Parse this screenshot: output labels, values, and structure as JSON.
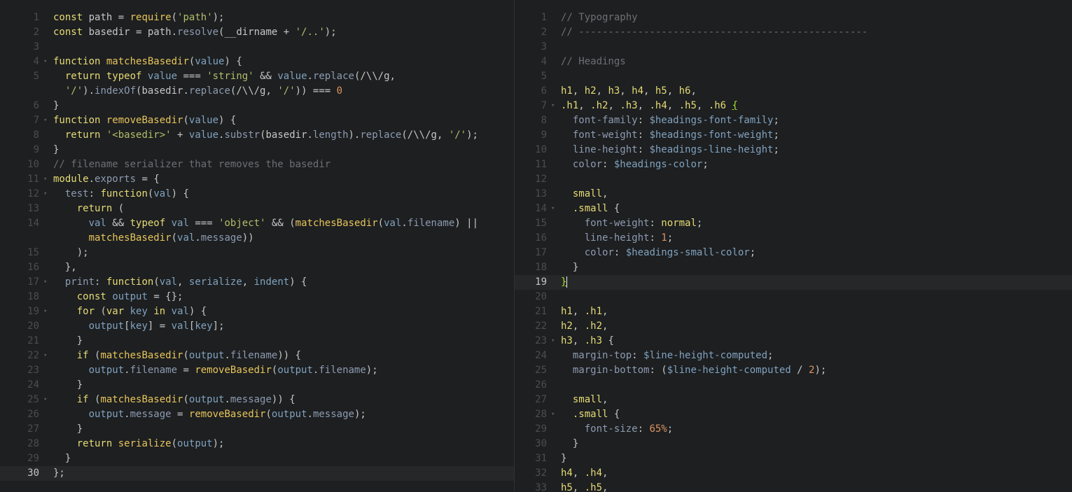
{
  "left_pane": {
    "lines": [
      {
        "n": "1",
        "fold": false,
        "html": "<span class=\"kw\">const</span> path = <span class=\"fn\">require</span>(<span class=\"str\">'path'</span>);"
      },
      {
        "n": "2",
        "fold": false,
        "html": "<span class=\"kw\">const</span> basedir = path.<span class=\"prop\">resolve</span>(__dirname + <span class=\"str\">'/..'</span>);"
      },
      {
        "n": "3",
        "fold": false,
        "html": ""
      },
      {
        "n": "4",
        "fold": true,
        "html": "<span class=\"kw\">function</span> <span class=\"fn\">matchesBasedir</span>(<span class=\"var\">value</span>) {"
      },
      {
        "n": "5",
        "fold": false,
        "html": "  <span class=\"kw\">return</span> <span class=\"kw\">typeof</span> <span class=\"var\">value</span> === <span class=\"str\">'string'</span> &amp;&amp; <span class=\"var\">value</span>.<span class=\"prop\">replace</span>(/\\\\/g,"
      },
      {
        "n": "",
        "fold": false,
        "html": "  <span class=\"str\">'/'</span>).<span class=\"prop\">indexOf</span>(basedir.<span class=\"prop\">replace</span>(/\\\\/g, <span class=\"str\">'/'</span>)) === <span class=\"num\">0</span>"
      },
      {
        "n": "6",
        "fold": false,
        "html": "}"
      },
      {
        "n": "7",
        "fold": true,
        "html": "<span class=\"kw\">function</span> <span class=\"fn\">removeBasedir</span>(<span class=\"var\">value</span>) {"
      },
      {
        "n": "8",
        "fold": false,
        "html": "  <span class=\"kw\">return</span> <span class=\"str\">'&lt;basedir&gt;'</span> + <span class=\"var\">value</span>.<span class=\"prop\">substr</span>(basedir.<span class=\"prop\">length</span>).<span class=\"prop\">replace</span>(/\\\\/g, <span class=\"str\">'/'</span>);"
      },
      {
        "n": "9",
        "fold": false,
        "html": "}"
      },
      {
        "n": "10",
        "fold": false,
        "html": "<span class=\"cmt\">// filename serializer that removes the basedir</span>"
      },
      {
        "n": "11",
        "fold": true,
        "html": "<span class=\"kw\">module</span>.<span class=\"prop\">exports</span> = {"
      },
      {
        "n": "12",
        "fold": true,
        "html": "  <span class=\"prop\">test</span>: <span class=\"kw\">function</span>(<span class=\"var\">val</span>) {"
      },
      {
        "n": "13",
        "fold": false,
        "html": "    <span class=\"kw\">return</span> ("
      },
      {
        "n": "14",
        "fold": false,
        "html": "      <span class=\"var\">val</span> &amp;&amp; <span class=\"kw\">typeof</span> <span class=\"var\">val</span> === <span class=\"str\">'object'</span> &amp;&amp; (<span class=\"fn\">matchesBasedir</span>(<span class=\"var\">val</span>.<span class=\"prop\">filename</span>) ||"
      },
      {
        "n": "",
        "fold": false,
        "html": "      <span class=\"fn\">matchesBasedir</span>(<span class=\"var\">val</span>.<span class=\"prop\">message</span>))"
      },
      {
        "n": "15",
        "fold": false,
        "html": "    );"
      },
      {
        "n": "16",
        "fold": false,
        "html": "  },"
      },
      {
        "n": "17",
        "fold": true,
        "html": "  <span class=\"prop\">print</span>: <span class=\"kw\">function</span>(<span class=\"var\">val</span>, <span class=\"var\">serialize</span>, <span class=\"var\">indent</span>) {"
      },
      {
        "n": "18",
        "fold": false,
        "html": "    <span class=\"kw\">const</span> <span class=\"var\">output</span> = {};"
      },
      {
        "n": "19",
        "fold": true,
        "html": "    <span class=\"kw\">for</span> (<span class=\"kw\">var</span> <span class=\"var\">key</span> <span class=\"kw\">in</span> <span class=\"var\">val</span>) {"
      },
      {
        "n": "20",
        "fold": false,
        "html": "      <span class=\"var\">output</span>[<span class=\"var\">key</span>] = <span class=\"var\">val</span>[<span class=\"var\">key</span>];"
      },
      {
        "n": "21",
        "fold": false,
        "html": "    }"
      },
      {
        "n": "22",
        "fold": true,
        "html": "    <span class=\"kw\">if</span> (<span class=\"fn\">matchesBasedir</span>(<span class=\"var\">output</span>.<span class=\"prop\">filename</span>)) {"
      },
      {
        "n": "23",
        "fold": false,
        "html": "      <span class=\"var\">output</span>.<span class=\"prop\">filename</span> = <span class=\"fn\">removeBasedir</span>(<span class=\"var\">output</span>.<span class=\"prop\">filename</span>);"
      },
      {
        "n": "24",
        "fold": false,
        "html": "    }"
      },
      {
        "n": "25",
        "fold": true,
        "html": "    <span class=\"kw\">if</span> (<span class=\"fn\">matchesBasedir</span>(<span class=\"var\">output</span>.<span class=\"prop\">message</span>)) {"
      },
      {
        "n": "26",
        "fold": false,
        "html": "      <span class=\"var\">output</span>.<span class=\"prop\">message</span> = <span class=\"fn\">removeBasedir</span>(<span class=\"var\">output</span>.<span class=\"prop\">message</span>);"
      },
      {
        "n": "27",
        "fold": false,
        "html": "    }"
      },
      {
        "n": "28",
        "fold": false,
        "html": "    <span class=\"kw\">return</span> <span class=\"fn\">serialize</span>(<span class=\"var\">output</span>);"
      },
      {
        "n": "29",
        "fold": false,
        "html": "  }"
      },
      {
        "n": "30",
        "fold": false,
        "html": "};",
        "current": true
      }
    ]
  },
  "right_pane": {
    "lines": [
      {
        "n": "1",
        "fold": false,
        "html": "<span class=\"cmt\">// Typography</span>"
      },
      {
        "n": "2",
        "fold": false,
        "html": "<span class=\"cmt\">// -------------------------------------------------</span>"
      },
      {
        "n": "3",
        "fold": false,
        "html": ""
      },
      {
        "n": "4",
        "fold": false,
        "html": "<span class=\"cmt\">// Headings</span>"
      },
      {
        "n": "5",
        "fold": false,
        "html": ""
      },
      {
        "n": "6",
        "fold": false,
        "html": "<span class=\"kw\">h1</span>, <span class=\"kw\">h2</span>, <span class=\"kw\">h3</span>, <span class=\"kw\">h4</span>, <span class=\"kw\">h5</span>, <span class=\"kw\">h6</span>,"
      },
      {
        "n": "7",
        "fold": true,
        "html": "<span class=\"kw\">.h1</span>, <span class=\"kw\">.h2</span>, <span class=\"kw\">.h3</span>, <span class=\"kw\">.h4</span>, <span class=\"kw\">.h5</span>, <span class=\"kw\">.h6</span> <span class=\"brace-match\">{</span>"
      },
      {
        "n": "8",
        "fold": false,
        "html": "  <span class=\"prop\">font-family</span>: <span class=\"var\">$headings-font-family</span>;"
      },
      {
        "n": "9",
        "fold": false,
        "html": "  <span class=\"prop\">font-weight</span>: <span class=\"var\">$headings-font-weight</span>;"
      },
      {
        "n": "10",
        "fold": false,
        "html": "  <span class=\"prop\">line-height</span>: <span class=\"var\">$headings-line-height</span>;"
      },
      {
        "n": "11",
        "fold": false,
        "html": "  <span class=\"prop\">color</span>: <span class=\"var\">$headings-color</span>;"
      },
      {
        "n": "12",
        "fold": false,
        "html": ""
      },
      {
        "n": "13",
        "fold": false,
        "html": "  <span class=\"kw\">small</span>,"
      },
      {
        "n": "14",
        "fold": true,
        "html": "  <span class=\"kw\">.small</span> {"
      },
      {
        "n": "15",
        "fold": false,
        "html": "    <span class=\"prop\">font-weight</span>: <span class=\"kw\">normal</span>;"
      },
      {
        "n": "16",
        "fold": false,
        "html": "    <span class=\"prop\">line-height</span>: <span class=\"num\">1</span>;"
      },
      {
        "n": "17",
        "fold": false,
        "html": "    <span class=\"prop\">color</span>: <span class=\"var\">$headings-small-color</span>;"
      },
      {
        "n": "18",
        "fold": false,
        "html": "  }"
      },
      {
        "n": "19",
        "fold": false,
        "html": "<span class=\"brace-match cursor\">}</span>",
        "current": true
      },
      {
        "n": "20",
        "fold": false,
        "html": ""
      },
      {
        "n": "21",
        "fold": false,
        "html": "<span class=\"kw\">h1</span>, <span class=\"kw\">.h1</span>,"
      },
      {
        "n": "22",
        "fold": false,
        "html": "<span class=\"kw\">h2</span>, <span class=\"kw\">.h2</span>,"
      },
      {
        "n": "23",
        "fold": true,
        "html": "<span class=\"kw\">h3</span>, <span class=\"kw\">.h3</span> {"
      },
      {
        "n": "24",
        "fold": false,
        "html": "  <span class=\"prop\">margin-top</span>: <span class=\"var\">$line-height-computed</span>;"
      },
      {
        "n": "25",
        "fold": false,
        "html": "  <span class=\"prop\">margin-bottom</span>: (<span class=\"var\">$line-height-computed</span> / <span class=\"num\">2</span>);"
      },
      {
        "n": "26",
        "fold": false,
        "html": ""
      },
      {
        "n": "27",
        "fold": false,
        "html": "  <span class=\"kw\">small</span>,"
      },
      {
        "n": "28",
        "fold": true,
        "html": "  <span class=\"kw\">.small</span> {"
      },
      {
        "n": "29",
        "fold": false,
        "html": "    <span class=\"prop\">font-size</span>: <span class=\"num\">65%</span>;"
      },
      {
        "n": "30",
        "fold": false,
        "html": "  }"
      },
      {
        "n": "31",
        "fold": false,
        "html": "}"
      },
      {
        "n": "32",
        "fold": false,
        "html": "<span class=\"kw\">h4</span>, <span class=\"kw\">.h4</span>,"
      },
      {
        "n": "33",
        "fold": false,
        "html": "<span class=\"kw\">h5</span>, <span class=\"kw\">.h5</span>,"
      }
    ]
  },
  "icons": {
    "fold": "fold-arrow-icon"
  }
}
